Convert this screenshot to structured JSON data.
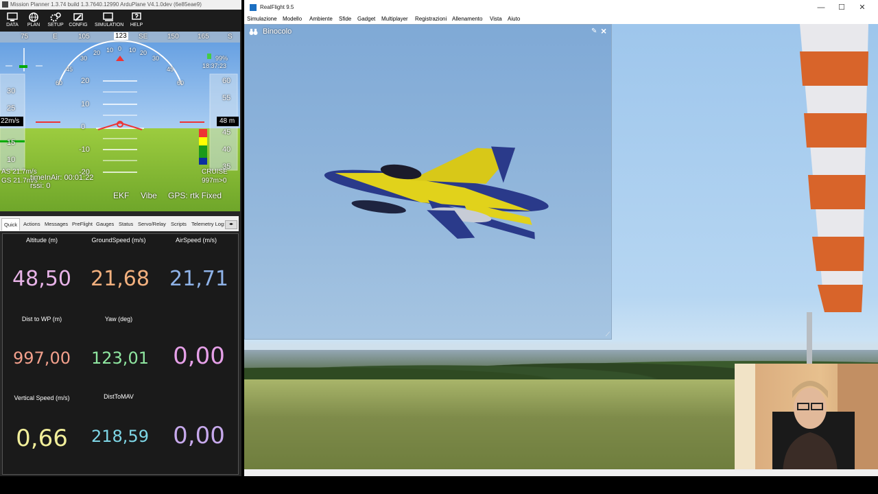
{
  "mission_planner": {
    "title": "Mission Planner 1.3.74 build 1.3.7640.12990 ArduPlane V4.1.0dev (6e85eae9)",
    "toolbar": [
      {
        "label": "DATA",
        "icon": "monitor-icon"
      },
      {
        "label": "PLAN",
        "icon": "globe-icon"
      },
      {
        "label": "SETUP",
        "icon": "gears-icon"
      },
      {
        "label": "CONFIG",
        "icon": "wrench-icon"
      },
      {
        "label": "SIMULATION",
        "icon": "computer-icon"
      },
      {
        "label": "HELP",
        "icon": "help-icon"
      }
    ],
    "hud": {
      "heading_ticks": [
        "75",
        "E",
        "105",
        "123",
        "SE",
        "150",
        "165",
        "S"
      ],
      "battery": "99%",
      "clock": "18:37:23",
      "speed_readout": "22m/s",
      "alt_readout": "48 m",
      "speed_scale": [
        "30",
        "25",
        "15",
        "10"
      ],
      "alt_scale": [
        "60",
        "55",
        "45",
        "40",
        "35"
      ],
      "pitch_labels": [
        "20",
        "10",
        "0",
        "-10",
        "-20"
      ],
      "roll_labels": [
        "60",
        "45",
        "30",
        "20",
        "10",
        "0",
        "10",
        "20",
        "30",
        "45",
        "60"
      ],
      "as_text": "AS 21.7m/s",
      "gs_text": "GS 21.7m/s",
      "time_in_air": "timeInAir: 00:01:22",
      "rssi": "rssi: 0",
      "mode": "CRUISE",
      "wp_dist": "997m>0",
      "ekf": "EKF",
      "vibe": "Vibe",
      "gps": "GPS: rtk Fixed"
    },
    "tabs": [
      "Quick",
      "Actions",
      "Messages",
      "PreFlight",
      "Gauges",
      "Status",
      "Servo/Relay",
      "Scripts",
      "Telemetry Logs"
    ],
    "quick": [
      {
        "label": "Altitude (m)",
        "value": "48,50",
        "color": "#e8b3e8"
      },
      {
        "label": "GroundSpeed (m/s)",
        "value": "21,68",
        "color": "#f2b07e"
      },
      {
        "label": "AirSpeed (m/s)",
        "value": "21,71",
        "color": "#8fb3e8"
      },
      {
        "label": "Dist to WP (m)",
        "value": "997,00",
        "color": "#f3a08c"
      },
      {
        "label": "Yaw (deg)",
        "value": "123,01",
        "color": "#8fe6a0"
      },
      {
        "label": "",
        "value": "0,00",
        "color": "#e6a0e8"
      },
      {
        "label": "Vertical Speed (m/s)",
        "value": "0,66",
        "color": "#f1ee9a"
      },
      {
        "label": "DistToMAV",
        "value": "218,59",
        "color": "#7ed6e6"
      },
      {
        "label": "",
        "value": "0,00",
        "color": "#c7a9ec"
      }
    ]
  },
  "realflight": {
    "title": "RealFlight 9.5",
    "menu": [
      "Simulazione",
      "Modello",
      "Ambiente",
      "Sfide",
      "Gadget",
      "Multiplayer",
      "Registrazioni",
      "Allenamento",
      "Vista",
      "Aiuto"
    ],
    "binoculars_title": "Binocolo"
  }
}
